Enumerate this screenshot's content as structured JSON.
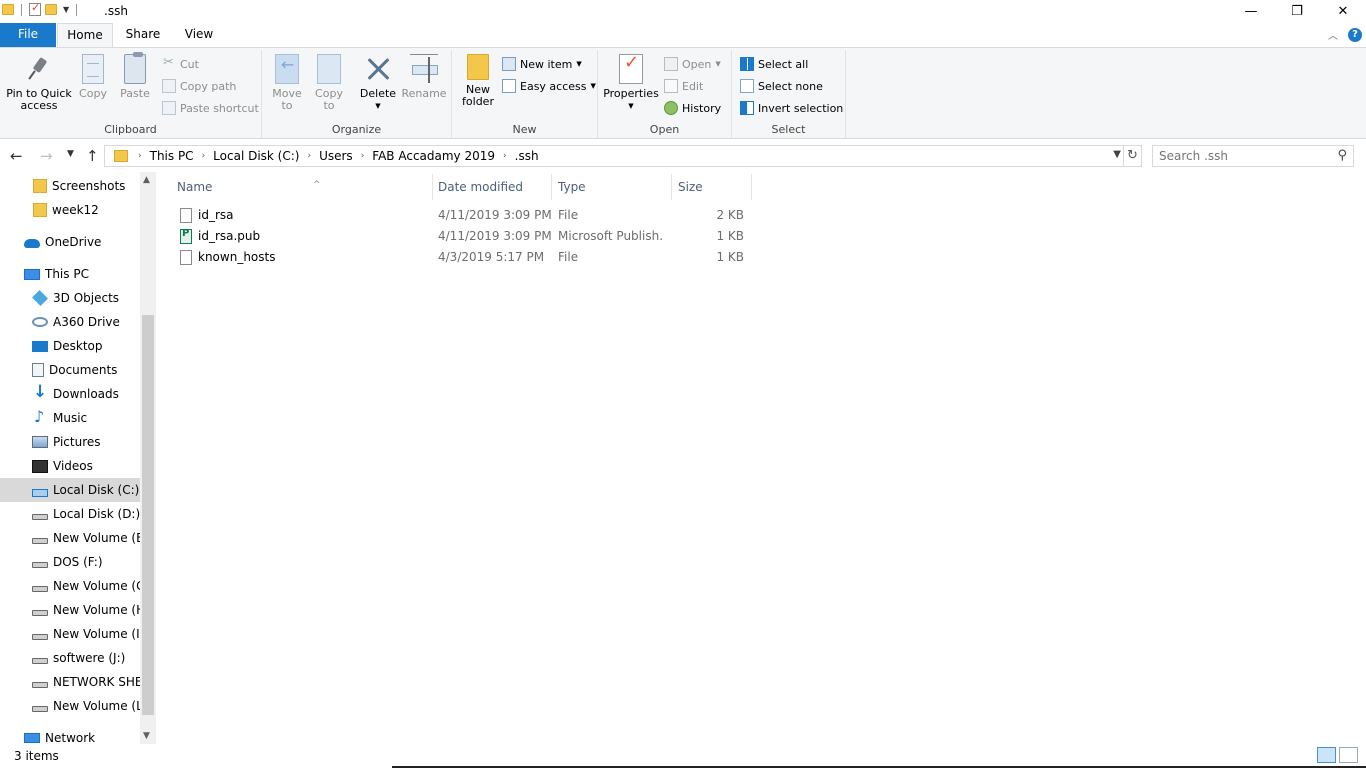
{
  "window": {
    "title": ".ssh"
  },
  "window_controls": {
    "minimize": "—",
    "maximize": "❐",
    "close": "✕"
  },
  "tabs": [
    {
      "label": "File"
    },
    {
      "label": "Home"
    },
    {
      "label": "Share"
    },
    {
      "label": "View"
    }
  ],
  "ribbon": {
    "clipboard": {
      "label": "Clipboard",
      "pin_line1": "Pin to Quick",
      "pin_line2": "access",
      "copy": "Copy",
      "paste": "Paste",
      "cut": "Cut",
      "copy_path": "Copy path",
      "paste_shortcut": "Paste shortcut"
    },
    "organize": {
      "label": "Organize",
      "move_line1": "Move",
      "move_line2": "to",
      "copy_line1": "Copy",
      "copy_line2": "to",
      "delete": "Delete",
      "rename": "Rename"
    },
    "new": {
      "label": "New",
      "new_folder_line1": "New",
      "new_folder_line2": "folder",
      "new_item": "New item",
      "easy_access": "Easy access"
    },
    "open": {
      "label": "Open",
      "properties": "Properties",
      "open": "Open",
      "edit": "Edit",
      "history": "History"
    },
    "select": {
      "label": "Select",
      "select_all": "Select all",
      "select_none": "Select none",
      "invert_selection": "Invert selection"
    }
  },
  "address": {
    "crumbs": [
      "This PC",
      "Local Disk (C:)",
      "Users",
      "FAB Accadamy 2019",
      ".ssh"
    ]
  },
  "search": {
    "placeholder": "Search .ssh"
  },
  "nav": {
    "items": [
      {
        "label": "Screenshots",
        "icon": "folder"
      },
      {
        "label": "week12",
        "icon": "folder"
      },
      {
        "label": "OneDrive",
        "icon": "cloud"
      },
      {
        "label": "This PC",
        "icon": "pc"
      },
      {
        "label": "3D Objects",
        "icon": "obj3d"
      },
      {
        "label": "A360 Drive",
        "icon": "a360"
      },
      {
        "label": "Desktop",
        "icon": "desktop"
      },
      {
        "label": "Documents",
        "icon": "docs"
      },
      {
        "label": "Downloads",
        "icon": "down"
      },
      {
        "label": "Music",
        "icon": "music"
      },
      {
        "label": "Pictures",
        "icon": "pics"
      },
      {
        "label": "Videos",
        "icon": "videos"
      },
      {
        "label": "Local Disk (C:)",
        "icon": "drive-c"
      },
      {
        "label": "Local Disk (D:)",
        "icon": "drive"
      },
      {
        "label": "New Volume (E:)",
        "icon": "drive"
      },
      {
        "label": "DOS (F:)",
        "icon": "drive"
      },
      {
        "label": "New Volume (G:",
        "icon": "drive"
      },
      {
        "label": "New Volume (H:",
        "icon": "drive"
      },
      {
        "label": "New Volume (I:)",
        "icon": "drive"
      },
      {
        "label": "softwere (J:)",
        "icon": "drive"
      },
      {
        "label": "NETWORK SHER",
        "icon": "drive"
      },
      {
        "label": "New Volume (L:)",
        "icon": "drive"
      },
      {
        "label": "Network",
        "icon": "network"
      }
    ]
  },
  "columns": {
    "name": "Name",
    "date": "Date modified",
    "type": "Type",
    "size": "Size"
  },
  "files": [
    {
      "name": "id_rsa",
      "date": "4/11/2019 3:09 PM",
      "type": "File",
      "size": "2 KB"
    },
    {
      "name": "id_rsa.pub",
      "date": "4/11/2019 3:09 PM",
      "type": "Microsoft Publish...",
      "size": "1 KB"
    },
    {
      "name": "known_hosts",
      "date": "4/3/2019 5:17 PM",
      "type": "File",
      "size": "1 KB"
    }
  ],
  "status": {
    "items_count": "3 items"
  }
}
